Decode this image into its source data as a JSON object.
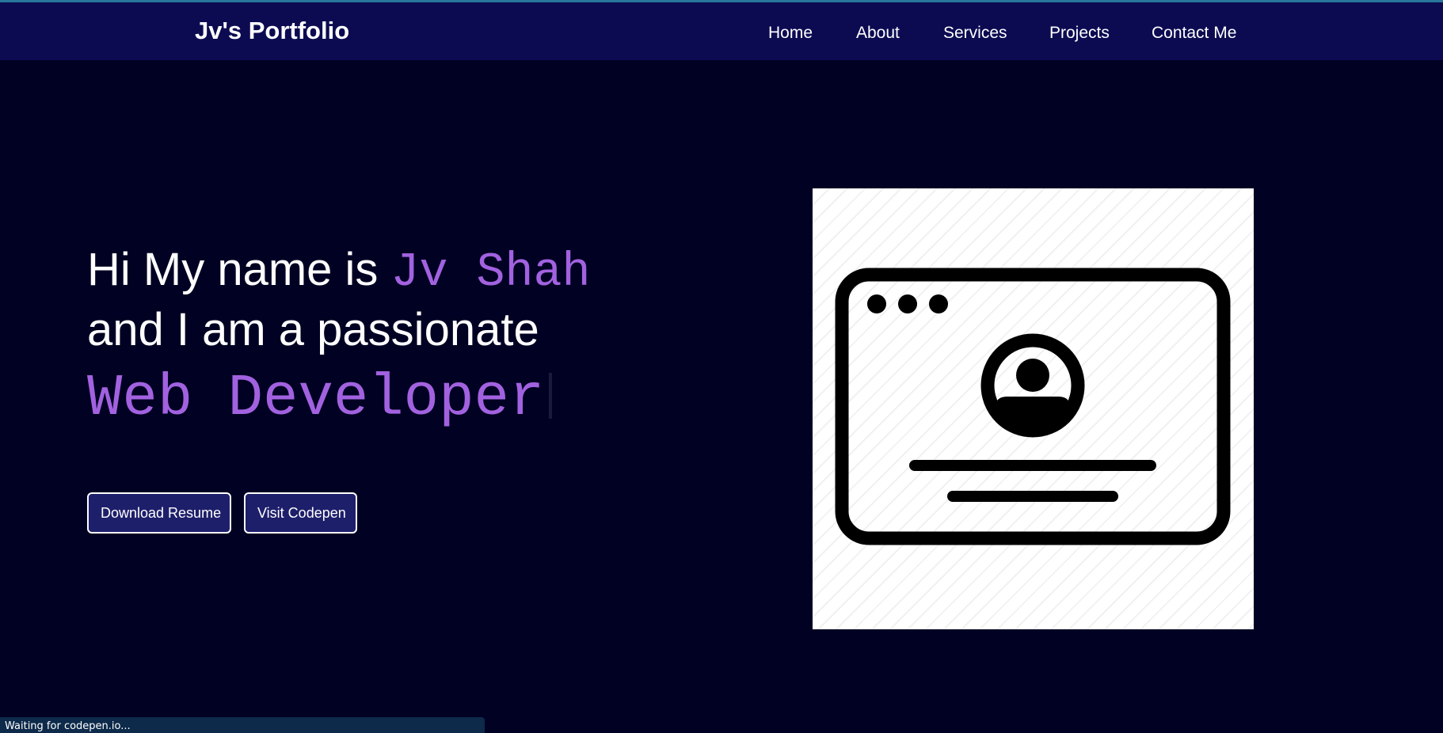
{
  "navbar": {
    "brand": "Jv's Portfolio",
    "links": [
      "Home",
      "About",
      "Services",
      "Projects",
      "Contact Me"
    ]
  },
  "hero": {
    "intro_prefix": "Hi My name is ",
    "name": "Jv Shah",
    "line2": "and I am a passionate",
    "role": "Web Developer",
    "buttons": {
      "resume": "Download Resume",
      "codepen": "Visit Codepen"
    },
    "illustration_icon": "profile-card-icon"
  },
  "status": {
    "text": "Waiting for codepen.io..."
  },
  "colors": {
    "background": "#010123",
    "navbar": "#0c0b52",
    "accent": "#a262e0",
    "button": "#1e1f6b",
    "status_bar": "#0d2a4a"
  }
}
